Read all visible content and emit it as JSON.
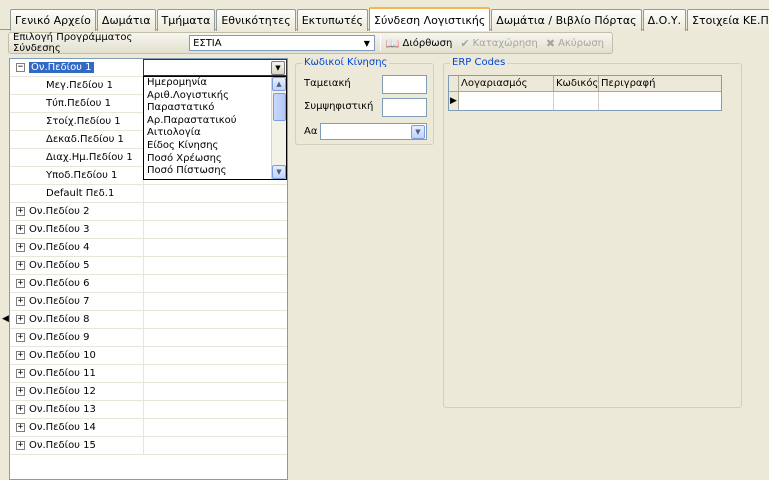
{
  "tabs": [
    {
      "label": "Γενικό Αρχείο"
    },
    {
      "label": "Δωμάτια"
    },
    {
      "label": "Τμήματα"
    },
    {
      "label": "Εθνικότητες"
    },
    {
      "label": "Εκτυπωτές"
    },
    {
      "label": "Σύνδεση Λογιστικής",
      "active": true
    },
    {
      "label": "Δωμάτια / Βιβλίο Πόρτας"
    },
    {
      "label": "Δ.Ο.Υ."
    },
    {
      "label": "Στοιχεία ΚΕ.Π.Υ.Ο."
    }
  ],
  "toolbar": {
    "program_label": "Επιλογή Προγράμματος Σύνδεσης",
    "program_value": "ΕΣΤΙΑ",
    "edit_label": "Διόρθωση",
    "save_label": "Καταχώρηση",
    "cancel_label": "Ακύρωση"
  },
  "tree": {
    "rows": [
      {
        "label": "Ον.Πεδίου 1",
        "expander": "−",
        "selected": true
      },
      {
        "label": "Μεγ.Πεδίου 1",
        "child": true
      },
      {
        "label": "Τύπ.Πεδίου 1",
        "child": true
      },
      {
        "label": "Στοίχ.Πεδίου 1",
        "child": true
      },
      {
        "label": "Δεκαδ.Πεδίου 1",
        "child": true
      },
      {
        "label": "Διαχ.Ημ.Πεδίου 1",
        "child": true
      },
      {
        "label": "Υποδ.Πεδίου 1",
        "child": true
      },
      {
        "label": "Default Πεδ.1",
        "child": true
      },
      {
        "label": "Ον.Πεδίου 2",
        "expander": "+"
      },
      {
        "label": "Ον.Πεδίου 3",
        "expander": "+"
      },
      {
        "label": "Ον.Πεδίου 4",
        "expander": "+"
      },
      {
        "label": "Ον.Πεδίου 5",
        "expander": "+"
      },
      {
        "label": "Ον.Πεδίου 6",
        "expander": "+"
      },
      {
        "label": "Ον.Πεδίου 7",
        "expander": "+"
      },
      {
        "label": "Ον.Πεδίου 8",
        "expander": "+"
      },
      {
        "label": "Ον.Πεδίου 9",
        "expander": "+"
      },
      {
        "label": "Ον.Πεδίου 10",
        "expander": "+"
      },
      {
        "label": "Ον.Πεδίου 11",
        "expander": "+"
      },
      {
        "label": "Ον.Πεδίου 12",
        "expander": "+"
      },
      {
        "label": "Ον.Πεδίου 13",
        "expander": "+"
      },
      {
        "label": "Ον.Πεδίου 14",
        "expander": "+"
      },
      {
        "label": "Ον.Πεδίου 15",
        "expander": "+"
      }
    ]
  },
  "dropdown": {
    "options": [
      "Ημερομηνία",
      "Αριθ.Λογιστικής",
      "Παραστατικό",
      "Αρ.Παραστατικού",
      "Αιτιολογία",
      "Είδος Κίνησης",
      "Ποσό Χρέωσης",
      "Ποσό Πίστωσης"
    ]
  },
  "movement_codes": {
    "legend": "Κωδικοί Κίνησης",
    "cash_label": "Ταμειακή",
    "offset_label": "Συμψηφιστική",
    "aa_label": "Αα"
  },
  "erp": {
    "legend": "ERP Codes",
    "columns": [
      "Λογαριασμός",
      "Κωδικός",
      "Περιγραφή"
    ]
  },
  "colors": {
    "background": "#ece9d8",
    "selection": "#316ac5",
    "legend_text": "#0046d5",
    "active_tab_accent": "#f7b64b"
  }
}
